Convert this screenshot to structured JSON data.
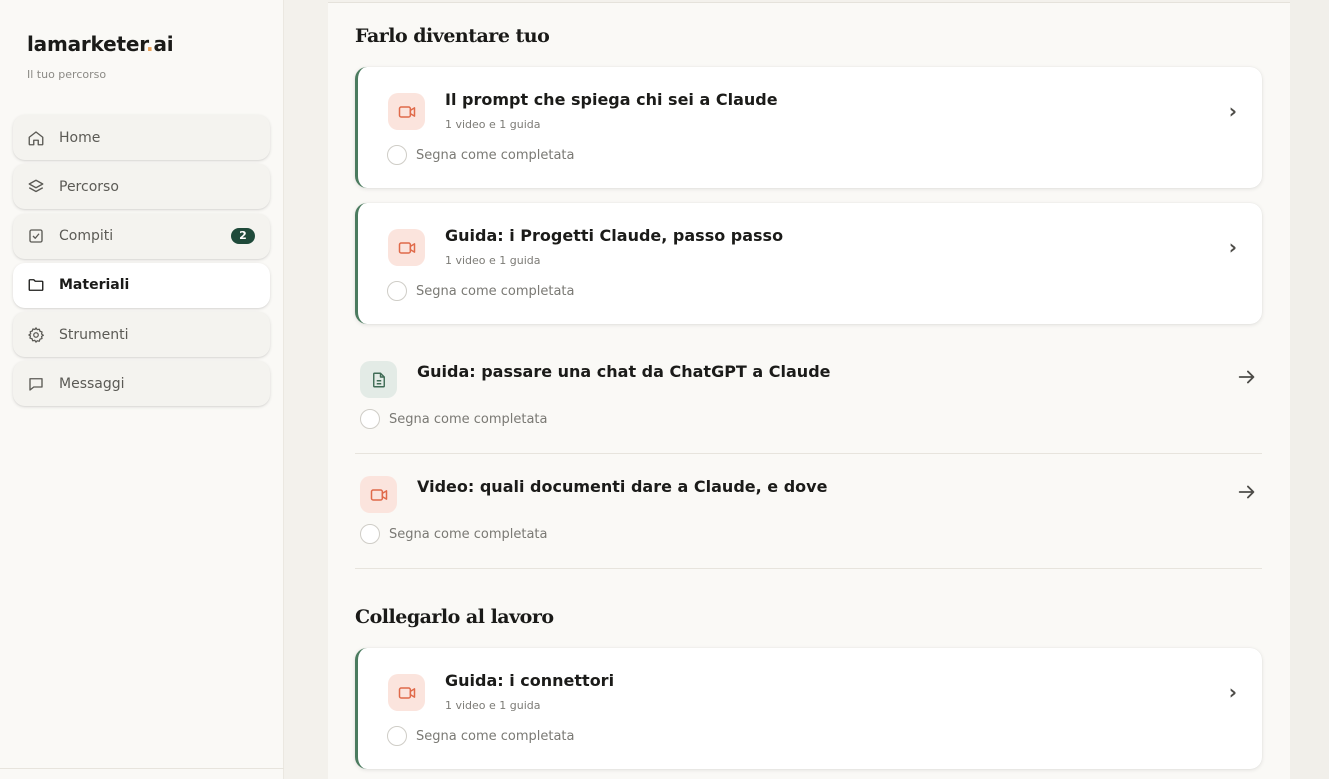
{
  "sidebar": {
    "brand_main": "lamarketer",
    "brand_dot": ".",
    "brand_tld": "ai",
    "tagline": "Il tuo percorso",
    "items": [
      {
        "label": "Home",
        "icon": "home-icon"
      },
      {
        "label": "Percorso",
        "icon": "layers-icon"
      },
      {
        "label": "Compiti",
        "icon": "checkbox-icon",
        "badge": "2"
      },
      {
        "label": "Materiali",
        "icon": "folder-icon",
        "active": true
      },
      {
        "label": "Strumenti",
        "icon": "gear-icon"
      },
      {
        "label": "Messaggi",
        "icon": "chat-icon"
      }
    ]
  },
  "main": {
    "sections": [
      {
        "title": "Farlo diventare tuo",
        "items": [
          {
            "title": "Il prompt che spiega chi sei a Claude",
            "subtitle": "1 video e 1 guida",
            "complete_label": "Segna come completata",
            "icon": "video-icon"
          },
          {
            "title": "Guida: i Progetti Claude, passo passo",
            "subtitle": "1 video e 1 guida",
            "complete_label": "Segna come completata",
            "icon": "video-icon"
          },
          {
            "title": "Guida: passare una chat da ChatGPT a Claude",
            "complete_label": "Segna come completata",
            "icon": "document-icon"
          },
          {
            "title": "Video: quali documenti dare a Claude, e dove",
            "complete_label": "Segna come completata",
            "icon": "video-icon"
          }
        ]
      },
      {
        "title": "Collegarlo al lavoro",
        "items": [
          {
            "title": "Guida: i connettori",
            "subtitle": "1 video e 1 guida",
            "complete_label": "Segna come completata",
            "icon": "video-icon"
          }
        ]
      }
    ],
    "chevron": "›"
  },
  "colors": {
    "accent_green": "#4b7b5f",
    "badge_green": "#1f4a3a",
    "video_icon": "#e06a4a",
    "video_bg": "#fbe4dd",
    "doc_icon": "#3f6b55",
    "doc_bg": "#e3ebe6",
    "brand_dot": "#e8a15a"
  }
}
